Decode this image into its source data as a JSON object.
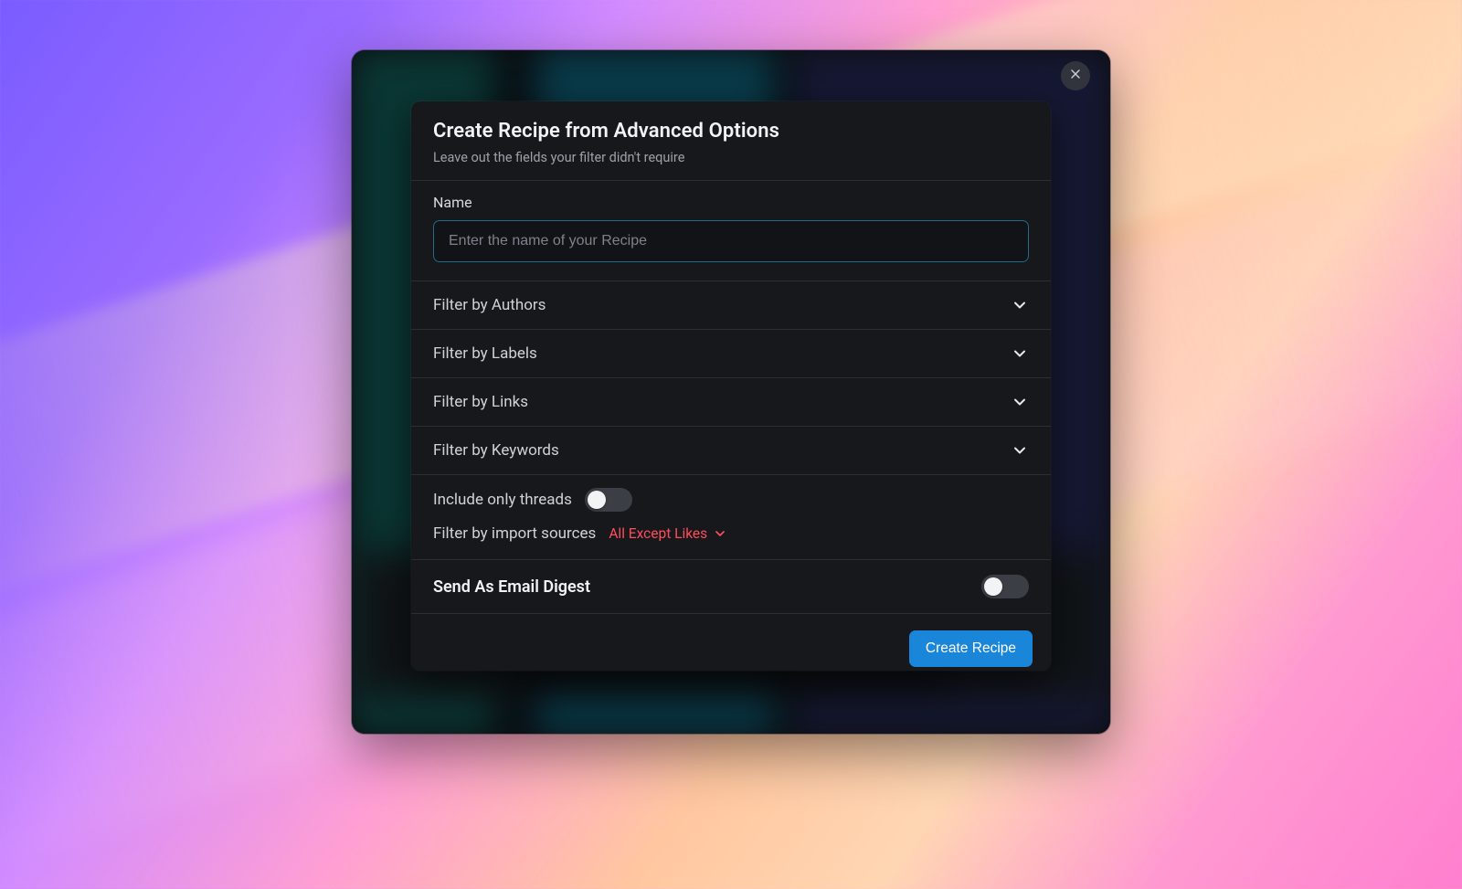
{
  "modal": {
    "title": "Create Recipe from Advanced Options",
    "subtitle": "Leave out the fields your filter didn't require",
    "name_field": {
      "label": "Name",
      "placeholder": "Enter the name of your Recipe",
      "value": ""
    },
    "accordions": [
      {
        "label": "Filter by Authors"
      },
      {
        "label": "Filter by Labels"
      },
      {
        "label": "Filter by Links"
      },
      {
        "label": "Filter by Keywords"
      }
    ],
    "threads_toggle": {
      "label": "Include only threads",
      "on": false
    },
    "import_sources": {
      "label": "Filter by import sources",
      "selected": "All Except Likes"
    },
    "digest": {
      "label": "Send As Email Digest",
      "on": false
    },
    "submit_label": "Create Recipe"
  },
  "colors": {
    "accent_blue": "#1a86d9",
    "danger_red": "#ff4d5a",
    "input_border": "#1f6b86"
  }
}
